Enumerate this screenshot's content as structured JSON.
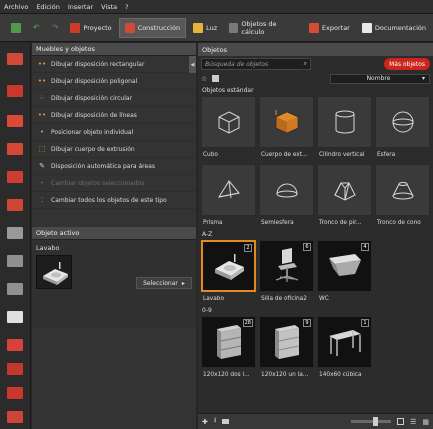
{
  "menu": [
    "Archivo",
    "Edición",
    "Insertar",
    "Vista",
    "?"
  ],
  "toolbar": {
    "tabs": [
      {
        "label": "Proyecto",
        "icon": "project-icon",
        "color": "#cf3b2a",
        "active": false
      },
      {
        "label": "Construcción",
        "icon": "construction-icon",
        "color": "#d04a35",
        "active": true
      },
      {
        "label": "Luz",
        "icon": "light-icon",
        "color": "#e8b23c",
        "active": false
      },
      {
        "label": "Objetos de cálculo",
        "icon": "calc-object-icon",
        "color": "#7a7a7a",
        "active": false
      },
      {
        "label": "Exportar",
        "icon": "export-icon",
        "color": "#d74a33",
        "active": false
      },
      {
        "label": "Documentación",
        "icon": "documentation-icon",
        "color": "#e8e8e8",
        "active": false
      }
    ]
  },
  "leftpanel": {
    "header": "Muebles y objetos",
    "items": [
      {
        "label": "Dibujar disposición rectangular",
        "icon": "rect-layout-icon",
        "disabled": false
      },
      {
        "label": "Dibujar disposición poligonal",
        "icon": "polygon-layout-icon",
        "disabled": false
      },
      {
        "label": "Dibujar disposición circular",
        "icon": "circular-layout-icon",
        "disabled": false
      },
      {
        "label": "Dibujar disposición de líneas",
        "icon": "line-layout-icon",
        "disabled": false
      },
      {
        "label": "Posicionar objeto individual",
        "icon": "single-object-icon",
        "disabled": false
      },
      {
        "label": "Dibujar cuerpo de extrusión",
        "icon": "extrusion-icon",
        "disabled": false
      },
      {
        "label": "Disposición automática para áreas",
        "icon": "auto-layout-icon",
        "disabled": false
      },
      {
        "label": "Cambiar objetos seleccionados",
        "icon": "change-selected-icon",
        "disabled": true
      },
      {
        "label": "Cambiar todos los objetos de este tipo",
        "icon": "change-all-icon",
        "disabled": false
      }
    ],
    "active_header": "Objeto activo",
    "active_name": "Lavabo",
    "select_label": "Seleccionar"
  },
  "rightpanel": {
    "header": "Objetos",
    "search_placeholder": "Búsqueda de objetos",
    "more_label": "Más objetos",
    "sort_value": "Nombre",
    "std_label": "Objetos estándar",
    "standard": [
      {
        "label": "Cubo"
      },
      {
        "label": "Cuerpo de ext..."
      },
      {
        "label": "Cilindro vertical"
      },
      {
        "label": "Esfera"
      },
      {
        "label": "Prisma"
      },
      {
        "label": "Semiesfera"
      },
      {
        "label": "Tronco de pir..."
      },
      {
        "label": "Tronco de cono"
      }
    ],
    "az_label": "A-Z",
    "az": [
      {
        "label": "Lavabo",
        "badge": "2"
      },
      {
        "label": "Silla de oficina2",
        "badge": "6"
      },
      {
        "label": "WC",
        "badge": "4"
      }
    ],
    "num_label": "0-9",
    "num": [
      {
        "label": "120x120 dos l...",
        "badge": "28"
      },
      {
        "label": "120x120 un la...",
        "badge": "9"
      },
      {
        "label": "140x60 cúbica",
        "badge": "1"
      }
    ]
  }
}
